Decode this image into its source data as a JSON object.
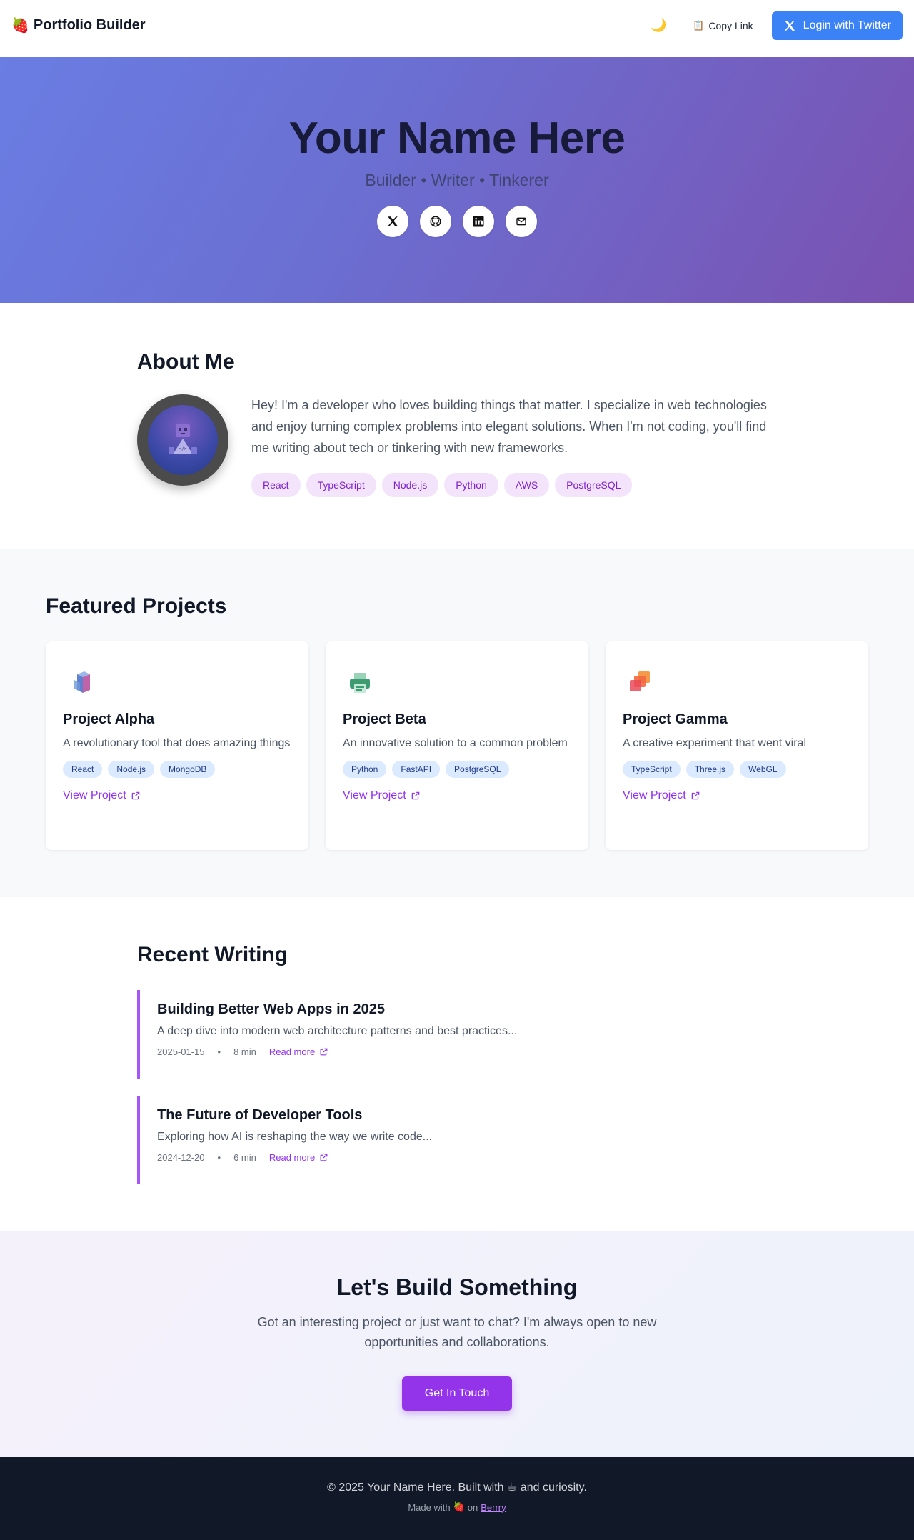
{
  "nav": {
    "brand_emoji": "🍓",
    "brand": "Portfolio Builder",
    "theme_icon": "🌙",
    "copy_icon": "📋",
    "copy_label": "Copy Link",
    "login_label": "Login with Twitter"
  },
  "hero": {
    "name": "Your Name Here",
    "tagline": "Builder • Writer • Tinkerer",
    "socials": [
      "x-icon",
      "github-icon",
      "linkedin-icon",
      "mail-icon"
    ]
  },
  "about": {
    "title": "About Me",
    "bio": "Hey! I'm a developer who loves building things that matter. I specialize in web technologies and enjoy turning complex problems into elegant solutions. When I'm not coding, you'll find me writing about tech or tinkering with new frameworks.",
    "skills": [
      "React",
      "TypeScript",
      "Node.js",
      "Python",
      "AWS",
      "PostgreSQL"
    ]
  },
  "projects": {
    "title": "Featured Projects",
    "items": [
      {
        "name": "Project Alpha",
        "desc": "A revolutionary tool that does amazing things",
        "tags": [
          "React",
          "Node.js",
          "MongoDB"
        ],
        "link": "View Project",
        "icon": "cube-icon"
      },
      {
        "name": "Project Beta",
        "desc": "An innovative solution to a common problem",
        "tags": [
          "Python",
          "FastAPI",
          "PostgreSQL"
        ],
        "link": "View Project",
        "icon": "printer-icon"
      },
      {
        "name": "Project Gamma",
        "desc": "A creative experiment that went viral",
        "tags": [
          "TypeScript",
          "Three.js",
          "WebGL"
        ],
        "link": "View Project",
        "icon": "layers-icon"
      }
    ]
  },
  "writing": {
    "title": "Recent Writing",
    "posts": [
      {
        "title": "Building Better Web Apps in 2025",
        "excerpt": "A deep dive into modern web architecture patterns and best practices...",
        "date": "2025-01-15",
        "read": "8 min",
        "link": "Read more"
      },
      {
        "title": "The Future of Developer Tools",
        "excerpt": "Exploring how AI is reshaping the way we write code...",
        "date": "2024-12-20",
        "read": "6 min",
        "link": "Read more"
      }
    ]
  },
  "cta": {
    "title": "Let's Build Something",
    "text": "Got an interesting project or just want to chat? I'm always open to new opportunities and collaborations.",
    "button": "Get In Touch"
  },
  "footer": {
    "copy": "© 2025 Your Name Here. Built with ☕ and curiosity.",
    "made_prefix": "Made with",
    "made_emoji": "🍓",
    "made_on": "on",
    "made_link": "Berrry"
  },
  "colors": {
    "accent": "#9333ea",
    "twitter_button": "#3b82f6",
    "hero_start": "#6a7de3",
    "hero_end": "#7a52b1"
  }
}
